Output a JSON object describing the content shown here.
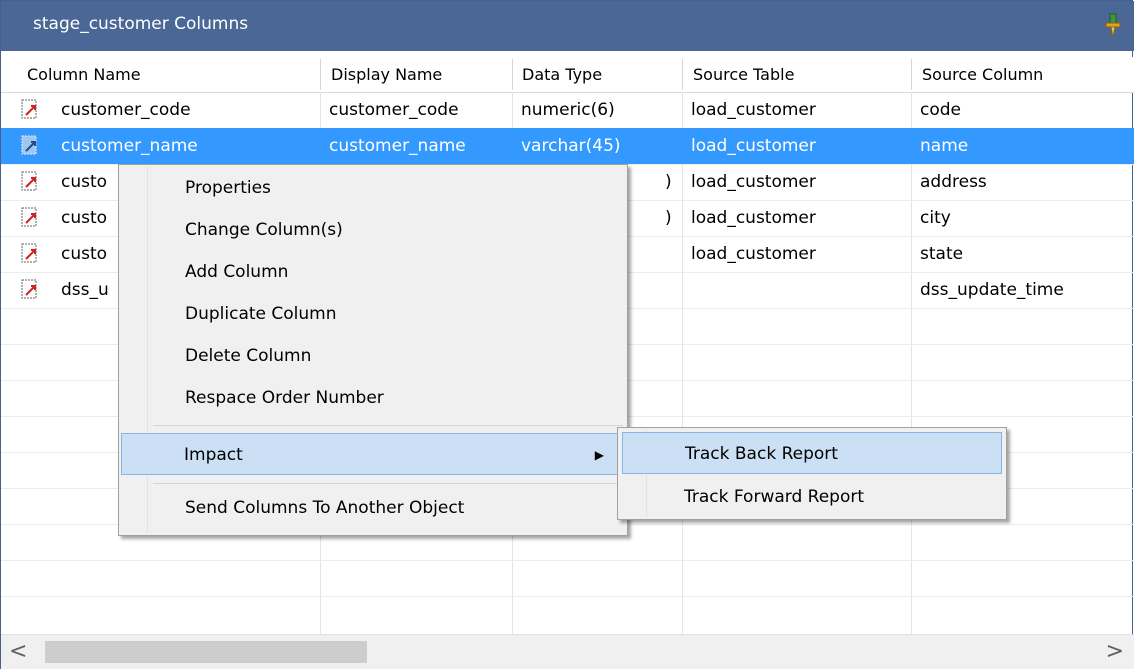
{
  "window": {
    "title": "stage_customer Columns",
    "pin_icon": "pin-icon"
  },
  "columns": [
    "Column Name",
    "Display Name",
    "Data Type",
    "Source Table",
    "Source Column"
  ],
  "rows": [
    {
      "name": "customer_code",
      "display": "customer_code",
      "type": "numeric(6)",
      "src_table": "load_customer",
      "src_col": "code",
      "selected": false
    },
    {
      "name": "customer_name",
      "display": "customer_name",
      "type": "varchar(45)",
      "src_table": "load_customer",
      "src_col": "name",
      "selected": true
    },
    {
      "name": "custo",
      "display": "",
      "type": ")",
      "src_table": "load_customer",
      "src_col": "address",
      "selected": false
    },
    {
      "name": "custo",
      "display": "",
      "type": ")",
      "src_table": "load_customer",
      "src_col": "city",
      "selected": false
    },
    {
      "name": "custo",
      "display": "",
      "type": "",
      "src_table": "load_customer",
      "src_col": "state",
      "selected": false
    },
    {
      "name": "dss_u",
      "display": "",
      "type": "",
      "src_table": "",
      "src_col": "dss_update_time",
      "selected": false
    }
  ],
  "context_menu": {
    "items": [
      {
        "label": "Properties"
      },
      {
        "label": "Change Column(s)"
      },
      {
        "label": "Add Column"
      },
      {
        "label": "Duplicate Column"
      },
      {
        "label": "Delete Column"
      },
      {
        "label": "Respace Order Number"
      },
      {
        "label": "Impact",
        "has_submenu": true,
        "highlighted": true
      },
      {
        "label": "Send Columns To Another Object"
      }
    ]
  },
  "submenu": {
    "items": [
      {
        "label": "Track Back Report",
        "highlighted": true
      },
      {
        "label": "Track Forward Report"
      }
    ]
  },
  "scrollbar": {
    "left_arrow": "<",
    "right_arrow": ">"
  },
  "colors": {
    "titlebar": "#4a6796",
    "selection": "#3399ff",
    "menu_bg": "#f0f0f0",
    "menu_highlight": "#cce0f5"
  }
}
